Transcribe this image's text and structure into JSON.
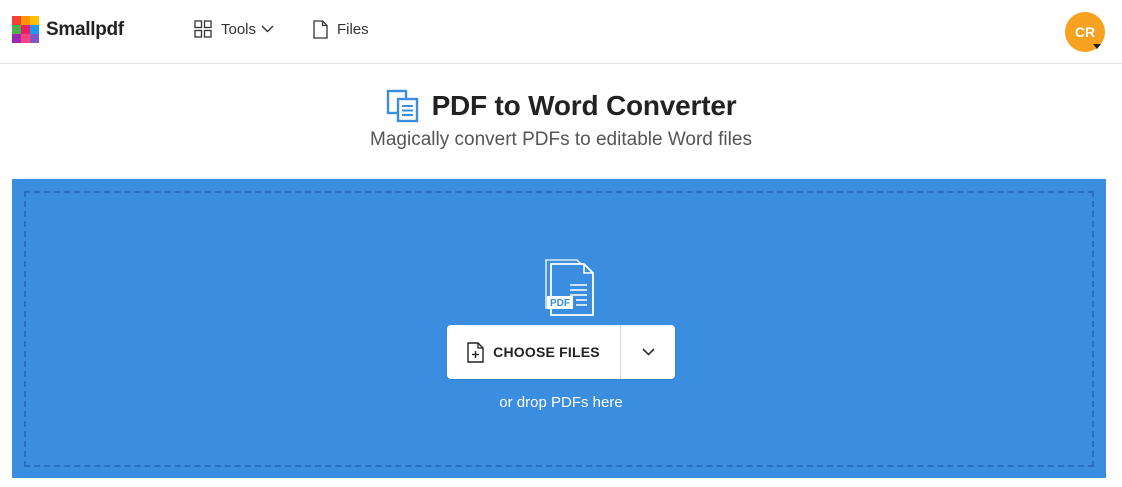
{
  "header": {
    "logo_text": "Smallpdf",
    "logo_colors": [
      "#f44336",
      "#ff9800",
      "#4caf50",
      "#9c27b0",
      "#e91e63",
      "#2196f3",
      "#673ab7",
      "#ff4081",
      "#00bcd4"
    ],
    "nav": {
      "tools_label": "Tools",
      "files_label": "Files"
    },
    "avatar_initials": "CR",
    "avatar_color": "#f7a120"
  },
  "main": {
    "title": "PDF to Word Converter",
    "subtitle": "Magically convert PDFs to editable Word files",
    "accent_color": "#3b8de0"
  },
  "dropzone": {
    "illustration_label": "PDF",
    "choose_files_label": "CHOOSE FILES",
    "hint": "or drop PDFs here"
  },
  "icons": {
    "tools": "grid-icon",
    "tools_chevron": "chevron-down-icon",
    "files": "file-icon",
    "title": "pdf-to-word-icon",
    "choose": "file-plus-icon",
    "more": "chevron-down-icon"
  }
}
